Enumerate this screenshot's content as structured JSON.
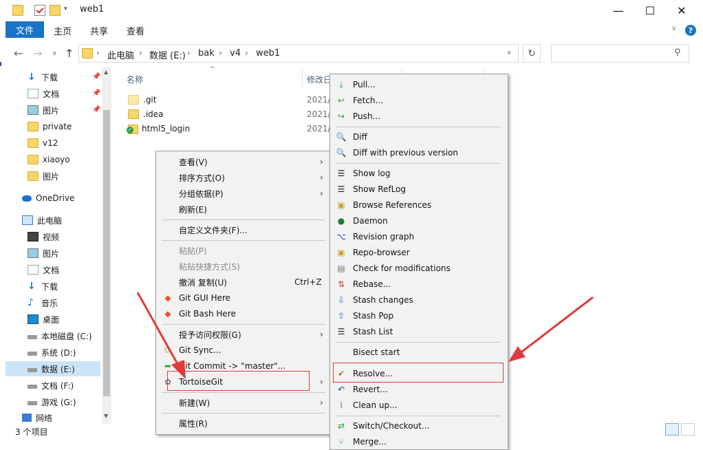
{
  "window": {
    "title": "web1",
    "minimize": "—",
    "maximize": "☐",
    "close": "✕"
  },
  "ribbon": {
    "file": "文件",
    "tabs": [
      "主页",
      "共享",
      "查看"
    ],
    "help": "?",
    "expand": "∨"
  },
  "nav": {
    "back": "←",
    "forward": "→",
    "recent": "∨",
    "up": "↑",
    "refresh": "↻",
    "dropdown": "∨",
    "search_icon": "⚲"
  },
  "breadcrumb": [
    "此电脑",
    "数据 (E:)",
    "bak",
    "v4",
    "web1"
  ],
  "sidebar": {
    "items": [
      {
        "label": "下载",
        "icon": "download-icon",
        "pinned": true
      },
      {
        "label": "文档",
        "icon": "document-icon",
        "pinned": true
      },
      {
        "label": "图片",
        "icon": "picture-icon",
        "pinned": true
      },
      {
        "label": "private",
        "icon": "folder-icon",
        "pinned": false
      },
      {
        "label": "v12",
        "icon": "folder-icon",
        "pinned": false
      },
      {
        "label": "xiaoyo",
        "icon": "folder-icon",
        "pinned": false
      },
      {
        "label": "图片",
        "icon": "folder-icon",
        "pinned": false
      },
      {
        "label": "OneDrive",
        "icon": "cloud-icon",
        "pinned": false
      },
      {
        "label": "此电脑",
        "icon": "computer-icon",
        "pinned": false
      },
      {
        "label": "视频",
        "icon": "video-icon",
        "pinned": false
      },
      {
        "label": "图片",
        "icon": "picture-icon",
        "pinned": false
      },
      {
        "label": "文档",
        "icon": "document-icon",
        "pinned": false
      },
      {
        "label": "下载",
        "icon": "download-icon",
        "pinned": false
      },
      {
        "label": "音乐",
        "icon": "music-icon",
        "pinned": false
      },
      {
        "label": "桌面",
        "icon": "desktop-icon",
        "pinned": false
      },
      {
        "label": "本地磁盘 (C:)",
        "icon": "drive-icon",
        "pinned": false
      },
      {
        "label": "系统 (D:)",
        "icon": "drive-icon",
        "pinned": false
      },
      {
        "label": "数据 (E:)",
        "icon": "drive-icon",
        "pinned": false,
        "selected": true
      },
      {
        "label": "文档 (F:)",
        "icon": "drive-icon",
        "pinned": false
      },
      {
        "label": "游戏 (G:)",
        "icon": "drive-icon",
        "pinned": false
      },
      {
        "label": "网络",
        "icon": "network-icon",
        "pinned": false
      }
    ]
  },
  "columns": {
    "name": "名称",
    "date": "修改日"
  },
  "files": [
    {
      "name": ".git",
      "date": "2021/",
      "icon": "folder-icon"
    },
    {
      "name": ".idea",
      "date": "2021/",
      "icon": "folder-icon"
    },
    {
      "name": "html5_login",
      "date": "2021/",
      "icon": "git-folder-icon"
    }
  ],
  "status": {
    "count": "3 个项目"
  },
  "context_menu": {
    "items": [
      {
        "label": "查看(V)",
        "submenu": true
      },
      {
        "label": "排序方式(O)",
        "submenu": true
      },
      {
        "label": "分组依据(P)",
        "submenu": true
      },
      {
        "label": "刷新(E)"
      },
      {
        "label": "自定义文件夹(F)..."
      },
      {
        "label": "粘贴(P)",
        "disabled": true
      },
      {
        "label": "粘贴快捷方式(S)",
        "disabled": true
      },
      {
        "label": "撤消 复制(U)",
        "shortcut": "Ctrl+Z"
      },
      {
        "label": "Git GUI Here",
        "icon": "git-gui-icon"
      },
      {
        "label": "Git Bash Here",
        "icon": "git-bash-icon"
      },
      {
        "label": "授予访问权限(G)",
        "submenu": true
      },
      {
        "label": "Git Sync...",
        "icon": "sync-icon"
      },
      {
        "label": "Git Commit -> \"master\"...",
        "icon": "commit-icon"
      },
      {
        "label": "TortoiseGit",
        "icon": "tortoisegit-icon",
        "submenu": true
      },
      {
        "label": "新建(W)",
        "submenu": true
      },
      {
        "label": "属性(R)"
      }
    ]
  },
  "tortoise_menu": {
    "items": [
      {
        "label": "Pull...",
        "icon": "pull-icon"
      },
      {
        "label": "Fetch...",
        "icon": "fetch-icon"
      },
      {
        "label": "Push...",
        "icon": "push-icon"
      },
      {
        "label": "Diff",
        "icon": "diff-icon"
      },
      {
        "label": "Diff with previous version",
        "icon": "diff-prev-icon"
      },
      {
        "label": "Show log",
        "icon": "log-icon"
      },
      {
        "label": "Show RefLog",
        "icon": "reflog-icon"
      },
      {
        "label": "Browse References",
        "icon": "references-icon"
      },
      {
        "label": "Daemon",
        "icon": "daemon-icon"
      },
      {
        "label": "Revision graph",
        "icon": "revision-graph-icon"
      },
      {
        "label": "Repo-browser",
        "icon": "repo-browser-icon"
      },
      {
        "label": "Check for modifications",
        "icon": "check-modifications-icon"
      },
      {
        "label": "Rebase...",
        "icon": "rebase-icon"
      },
      {
        "label": "Stash changes",
        "icon": "stash-icon"
      },
      {
        "label": "Stash Pop",
        "icon": "stash-pop-icon"
      },
      {
        "label": "Stash List",
        "icon": "stash-list-icon"
      },
      {
        "label": "Bisect start",
        "icon": "bisect-icon"
      },
      {
        "label": "Resolve...",
        "icon": "resolve-icon"
      },
      {
        "label": "Revert...",
        "icon": "revert-icon"
      },
      {
        "label": "Clean up...",
        "icon": "cleanup-icon"
      },
      {
        "label": "Switch/Checkout...",
        "icon": "switch-icon"
      },
      {
        "label": "Merge...",
        "icon": "merge-icon"
      }
    ]
  },
  "colors": {
    "accent": "#1a73c8",
    "highlight": "#e03a3a",
    "selection": "#cce4f7",
    "folder": "#f7d56b"
  }
}
